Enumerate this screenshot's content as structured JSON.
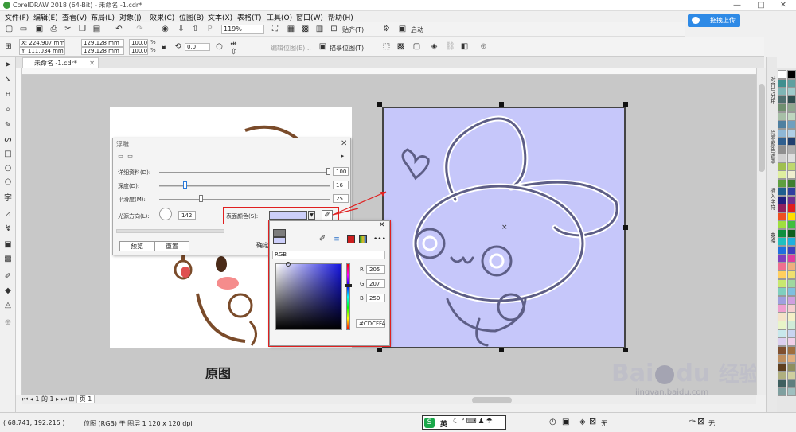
{
  "titlebar": {
    "title": "CorelDRAW 2018 (64-Bit) - 未命名 -1.cdr*",
    "minimize": "—",
    "maximize": "□",
    "close": "✕"
  },
  "menubar": {
    "items": [
      "文件(F)",
      "编辑(E)",
      "查看(V)",
      "布局(L)",
      "对象(J)",
      "效果(C)",
      "位图(B)",
      "文本(X)",
      "表格(T)",
      "工具(O)",
      "窗口(W)",
      "帮助(H)"
    ]
  },
  "std_toolbar": {
    "zoom": "119%",
    "snap": "贴齐(T)",
    "launch": "启动"
  },
  "upload_button": "拖拽上传",
  "property_bar": {
    "x": "X: 224.907 mm",
    "y": "Y: 111.034 mm",
    "w": "129.128 mm",
    "h": "129.128 mm",
    "sx": "100.0",
    "sy": "100.0",
    "unit": "%",
    "rotate": "0.0",
    "edit_bitmap": "编辑位图(E)...",
    "trace_bitmap": "描摹位图(T)"
  },
  "doc_tab": "未命名 -1.cdr*",
  "right_docker": {
    "tabs": [
      "对齐与分布",
      "位图颜色遮罩",
      "插入字符",
      "变换"
    ]
  },
  "emboss_dialog": {
    "title": "浮雕",
    "detail_label": "详细资料(D):",
    "detail": "100",
    "depth_label": "深度(D):",
    "depth": "16",
    "smooth_label": "平滑度(M):",
    "smooth": "25",
    "light_label": "光源方向(L):",
    "light": "142",
    "surface_label": "表面颜色(S):",
    "preview": "预览",
    "reset": "重置",
    "ok": "确定"
  },
  "color_picker": {
    "model": "RGB",
    "r": "205",
    "g": "207",
    "b": "250",
    "hex": "#CDCFFA",
    "r_label": "R",
    "g_label": "G",
    "b_label": "B"
  },
  "canvas": {
    "original_label": "原图"
  },
  "page_nav": {
    "page": "1",
    "of": "的",
    "total": "1",
    "tab": "页 1"
  },
  "statusbar": {
    "coords": "( 68.741, 192.215 )",
    "info": "位图 (RGB) 于 图层 1 120 x 120 dpi",
    "ime": "英",
    "fill_none": "无",
    "outline_none": "无"
  },
  "watermark": {
    "brand": "Bai",
    "brand2": "du",
    "cn": "经验",
    "url": "jingyan.baidu.com"
  },
  "colors": {
    "surface": "#CDCFFA",
    "highlight_red": "#e02020",
    "upload_blue": "#2e8ae6"
  },
  "palette": [
    "#ffffff",
    "#000000",
    "#3f8f8f",
    "#5fa0a0",
    "#7fb5b5",
    "#9fcaca",
    "#4f6f6f",
    "#2f4f4f",
    "#6f8f6f",
    "#8fa88f",
    "#a7bfa7",
    "#bfd6bf",
    "#4f7fa0",
    "#6f9fbf",
    "#8fb8d6",
    "#afcfe6",
    "#2f5f8f",
    "#1f3f6f",
    "#8f8f8f",
    "#afafaf",
    "#cfcfcf",
    "#dfdfdf",
    "#9fbf4f",
    "#bfd86f",
    "#dfef9f",
    "#efefcf",
    "#5f9f3f",
    "#3f7f2f",
    "#1f5f8f",
    "#2f3f9f",
    "#1f1f7f",
    "#6f2f8f",
    "#8f1f5f",
    "#df1f1f",
    "#ef4f1f",
    "#ffdf00",
    "#9fdf3f",
    "#3fbf3f",
    "#0f8f3f",
    "#0f5f1f",
    "#1fbfbf",
    "#1fafdf",
    "#1f6fdf",
    "#3f3fbf",
    "#7f3fbf",
    "#df3f9f",
    "#ef6f8f",
    "#efaf7f",
    "#ffcf5f",
    "#efe06f",
    "#c8e86f",
    "#9fd89f",
    "#7fcfbf",
    "#7fbfdf",
    "#9f9fdf",
    "#cf9fdf",
    "#ef9fcf",
    "#f4cfcf",
    "#f4e2c8",
    "#f4f0c8",
    "#e8f4c8",
    "#d0ecd8",
    "#c8e8ec",
    "#c8d4f0",
    "#dccff0",
    "#f0d0e8",
    "#7f4f2f",
    "#9f6f3f",
    "#bf8f5f",
    "#dfaf7f",
    "#5f3f1f",
    "#8f8f5f",
    "#afaf7f",
    "#cfcf9f",
    "#3f5f5f",
    "#5f7f7f",
    "#7f9f9f",
    "#9fbfbf"
  ]
}
